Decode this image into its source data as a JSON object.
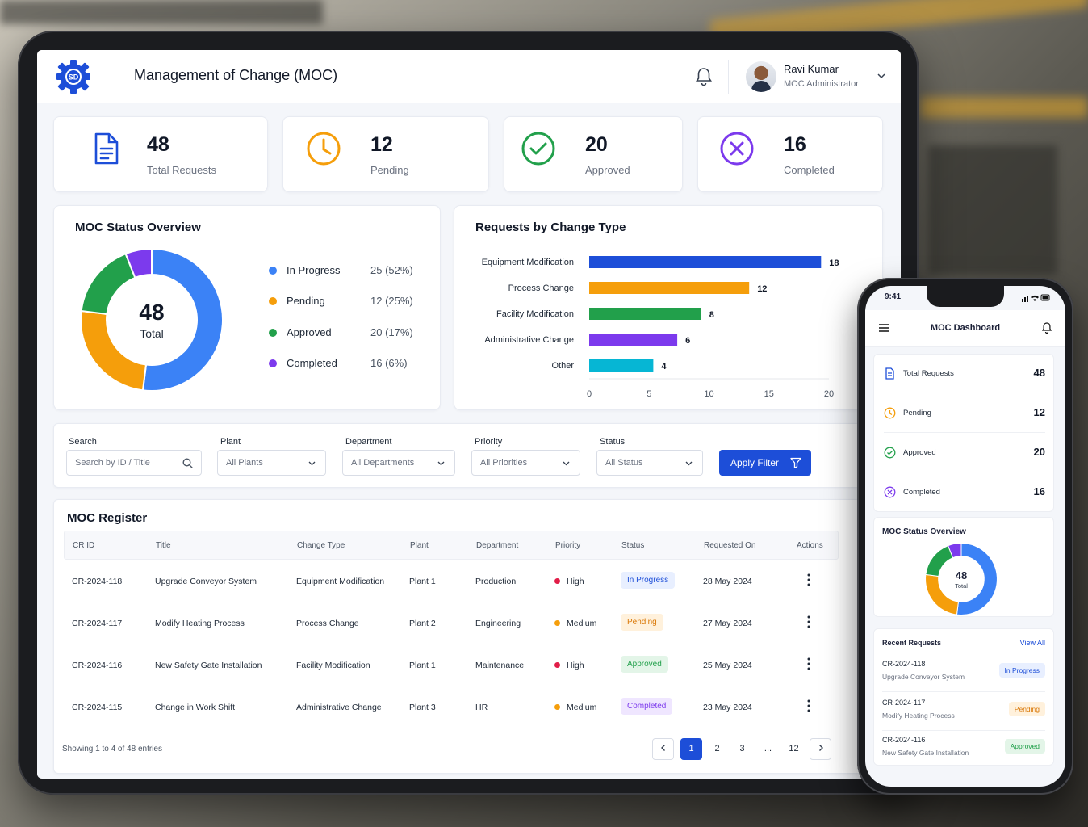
{
  "colors": {
    "primary": "#1d4ed8",
    "in_progress": "#3b82f6",
    "pending": "#f59e0b",
    "approved": "#22a04b",
    "completed": "#7c3aed",
    "other": "#06b6d4",
    "high": "#e11d48"
  },
  "header": {
    "logo_text": "SD",
    "title": "Management of Change (MOC)",
    "user_name": "Ravi Kumar",
    "user_role": "MOC Administrator"
  },
  "kpis": [
    {
      "value": "48",
      "label": "Total Requests",
      "icon": "document-icon"
    },
    {
      "value": "12",
      "label": "Pending",
      "icon": "clock-icon"
    },
    {
      "value": "20",
      "label": "Approved",
      "icon": "check-circle-icon"
    },
    {
      "value": "16",
      "label": "Completed",
      "icon": "x-circle-icon"
    }
  ],
  "status_overview": {
    "title": "MOC Status Overview",
    "center_value": "48",
    "center_label": "Total",
    "legend": [
      {
        "label": "In Progress",
        "value": "25 (52%)"
      },
      {
        "label": "Pending",
        "value": "12 (25%)"
      },
      {
        "label": "Approved",
        "value": "20 (17%)"
      },
      {
        "label": "Completed",
        "value": "16 (6%)"
      }
    ]
  },
  "chart_data": [
    {
      "type": "pie",
      "title": "MOC Status Overview",
      "categories": [
        "In Progress",
        "Pending",
        "Approved",
        "Completed"
      ],
      "values": [
        52,
        25,
        17,
        6
      ]
    },
    {
      "type": "bar",
      "title": "Requests by Change Type",
      "orientation": "horizontal",
      "categories": [
        "Equipment Modification",
        "Process Change",
        "Facility Modification",
        "Administrative Change",
        "Other"
      ],
      "values": [
        18,
        12,
        8,
        6,
        4
      ],
      "xticks": [
        "0",
        "5",
        "10",
        "15",
        "20"
      ],
      "xlim": [
        0,
        20
      ],
      "grid": false
    }
  ],
  "bar_chart": {
    "title": "Requests by Change Type"
  },
  "filters": {
    "search_label": "Search",
    "search_placeholder": "Search by ID / Title",
    "plant_label": "Plant",
    "plant_value": "All Plants",
    "department_label": "Department",
    "department_value": "All Departments",
    "priority_label": "Priority",
    "priority_value": "All Priorities",
    "status_label": "Status",
    "status_value": "All Status",
    "apply_label": "Apply Filter"
  },
  "register": {
    "title": "MOC Register",
    "columns": [
      "CR ID",
      "Title",
      "Change Type",
      "Plant",
      "Department",
      "Priority",
      "Status",
      "Requested On",
      "Actions"
    ],
    "rows": [
      {
        "id": "CR-2024-118",
        "title": "Upgrade Conveyor System",
        "type": "Equipment Modification",
        "plant": "Plant 1",
        "dept": "Production",
        "priority": "High",
        "status": "In Progress",
        "date": "28 May 2024"
      },
      {
        "id": "CR-2024-117",
        "title": "Modify Heating Process",
        "type": "Process Change",
        "plant": "Plant 2",
        "dept": "Engineering",
        "priority": "Medium",
        "status": "Pending",
        "date": "27 May 2024"
      },
      {
        "id": "CR-2024-116",
        "title": "New Safety Gate Installation",
        "type": "Facility Modification",
        "plant": "Plant 1",
        "dept": "Maintenance",
        "priority": "High",
        "status": "Approved",
        "date": "25 May 2024"
      },
      {
        "id": "CR-2024-115",
        "title": "Change in Work Shift",
        "type": "Administrative Change",
        "plant": "Plant 3",
        "dept": "HR",
        "priority": "Medium",
        "status": "Completed",
        "date": "23 May 2024"
      }
    ],
    "showing": "Showing 1 to 4 of 48 entries",
    "pages": [
      "1",
      "2",
      "3",
      "...",
      "12"
    ],
    "current_page": "1"
  },
  "phone": {
    "time": "9:41",
    "title": "MOC Dashboard",
    "kpis": [
      {
        "label": "Total Requests",
        "value": "48"
      },
      {
        "label": "Pending",
        "value": "12"
      },
      {
        "label": "Approved",
        "value": "20"
      },
      {
        "label": "Completed",
        "value": "16"
      }
    ],
    "overview_title": "MOC Status Overview",
    "donut_value": "48",
    "donut_label": "Total",
    "recent_title": "Recent Requests",
    "view_all": "View All",
    "recent": [
      {
        "id": "CR-2024-118",
        "title": "Upgrade Conveyor System",
        "status": "In Progress"
      },
      {
        "id": "CR-2024-117",
        "title": "Modify Heating Process",
        "status": "Pending"
      },
      {
        "id": "CR-2024-116",
        "title": "New Safety Gate Installation",
        "status": "Approved"
      }
    ]
  }
}
